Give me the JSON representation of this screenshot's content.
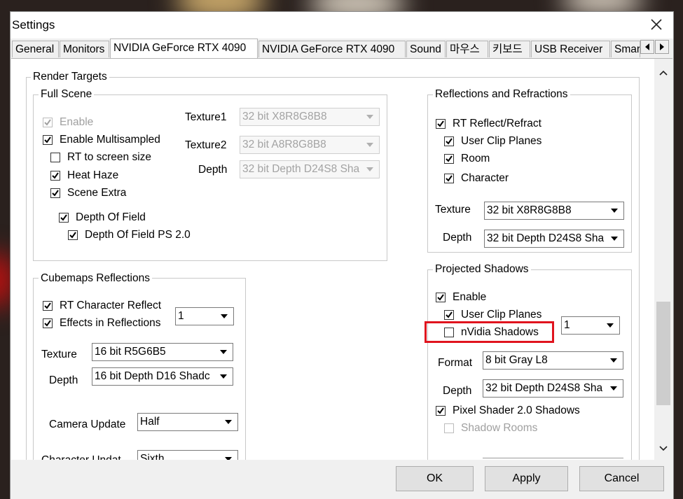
{
  "window": {
    "title": "Settings"
  },
  "tabs": [
    {
      "label": "General"
    },
    {
      "label": "Monitors"
    },
    {
      "label": "NVIDIA GeForce RTX 4090"
    },
    {
      "label": "NVIDIA GeForce RTX 4090"
    },
    {
      "label": "Sound"
    },
    {
      "label": "마우스"
    },
    {
      "label": "키보드"
    },
    {
      "label": "USB Receiver"
    },
    {
      "label": "Smar"
    }
  ],
  "render_targets": {
    "title": "Render Targets",
    "full_scene": {
      "title": "Full Scene",
      "enable": {
        "label": "Enable",
        "checked": true,
        "disabled": true
      },
      "enable_multisampled": {
        "label": "Enable Multisampled",
        "checked": true
      },
      "rt_to_screen_size": {
        "label": "RT to screen size",
        "checked": false
      },
      "heat_haze": {
        "label": "Heat Haze",
        "checked": true
      },
      "scene_extra": {
        "label": "Scene Extra",
        "checked": true
      },
      "depth_of_field": {
        "label": "Depth Of Field",
        "checked": true
      },
      "depth_of_field_ps2": {
        "label": "Depth Of Field PS 2.0",
        "checked": true
      },
      "texture1_label": "Texture1",
      "texture1_value": "32 bit X8R8G8B8",
      "texture2_label": "Texture2",
      "texture2_value": "32 bit A8R8G8B8",
      "depth_label": "Depth",
      "depth_value": "32 bit Depth D24S8 Sha"
    },
    "reflections": {
      "title": "Reflections and Refractions",
      "rt_reflect_refract": {
        "label": "RT Reflect/Refract",
        "checked": true
      },
      "user_clip_planes": {
        "label": "User Clip Planes",
        "checked": true
      },
      "room": {
        "label": "Room",
        "checked": true
      },
      "character": {
        "label": "Character",
        "checked": true
      },
      "texture_label": "Texture",
      "texture_value": "32 bit X8R8G8B8",
      "depth_label": "Depth",
      "depth_value": "32 bit Depth D24S8 Sha"
    },
    "cubemaps": {
      "title": "Cubemaps Reflections",
      "rt_character_reflect": {
        "label": "RT Character Reflect",
        "checked": true
      },
      "effects_in_reflections": {
        "label": "Effects in Reflections",
        "checked": true
      },
      "count_value": "1",
      "texture_label": "Texture",
      "texture_value": "16 bit R5G6B5",
      "depth_label": "Depth",
      "depth_value": "16 bit Depth D16 Shadc",
      "camera_update_label": "Camera Update",
      "camera_update_value": "Half",
      "partial_label": "Character Undat",
      "partial_value": "Sixth"
    },
    "projected_shadows": {
      "title": "Projected Shadows",
      "enable": {
        "label": "Enable",
        "checked": true
      },
      "user_clip_planes": {
        "label": "User Clip Planes",
        "checked": true
      },
      "nvidia_shadows": {
        "label": "nVidia Shadows",
        "checked": false
      },
      "count_value": "1",
      "format_label": "Format",
      "format_value": "8 bit Gray L8",
      "depth_label": "Depth",
      "depth_value": "32 bit Depth D24S8 Sha",
      "pixel_shader": {
        "label": "Pixel Shader 2.0 Shadows",
        "checked": true
      },
      "shadow_rooms": {
        "label": "Shadow Rooms",
        "checked": false,
        "disabled": true
      }
    }
  },
  "buttons": {
    "ok": "OK",
    "apply": "Apply",
    "cancel": "Cancel"
  },
  "colors": {
    "highlight": "#e0141e",
    "window_bg": "#f0f0f0"
  }
}
